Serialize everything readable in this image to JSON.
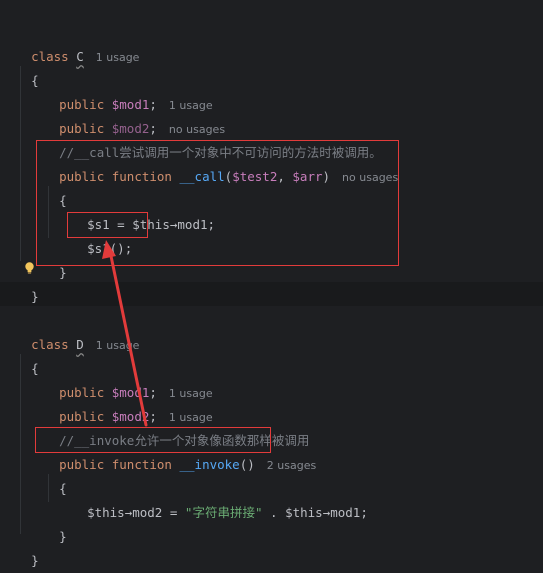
{
  "class_c": {
    "decl_kw": "class",
    "name": "C",
    "usage": "1 usage",
    "open": "{",
    "mod1": {
      "kw": "public",
      "var": "$mod1",
      "semi": ";",
      "usage": "1 usage"
    },
    "mod2": {
      "kw": "public",
      "var": "$mod2",
      "semi": ";",
      "usage": "no usages"
    },
    "comment_prefix": "//",
    "comment_code": "__call",
    "comment_text": "尝试调用一个对象中不可访问的方法时被调用。",
    "call_fn": {
      "kw1": "public",
      "kw2": "function",
      "name": "__call",
      "paren_open": "(",
      "arg1": "$test2",
      "comma": ", ",
      "arg2": "$arr",
      "paren_close": ")",
      "usage": "no usages"
    },
    "fn_open": "{",
    "line_assign": {
      "lhs": "$s1",
      "eq": " = ",
      "this": "$this",
      "arrow": "→",
      "prop": "mod1",
      "semi": ";"
    },
    "line_call": {
      "var": "$s1",
      "rest": "();"
    },
    "fn_close": "}",
    "close": "}"
  },
  "class_d": {
    "decl_kw": "class",
    "name": "D",
    "usage": "1 usage",
    "open": "{",
    "mod1": {
      "kw": "public",
      "var": "$mod1",
      "semi": ";",
      "usage": "1 usage"
    },
    "mod2": {
      "kw": "public",
      "var": "$mod2",
      "semi": ";",
      "usage": "1 usage"
    },
    "comment_prefix": "//",
    "comment_code": "__invoke",
    "comment_text": "允许一个对象像函数那样被调用",
    "invoke_fn": {
      "kw1": "public",
      "kw2": "function",
      "name": "__invoke",
      "parens": "()",
      "usage": "2 usages"
    },
    "fn_open": "{",
    "line_assign": {
      "this1": "$this",
      "arrow1": "→",
      "prop1": "mod2",
      "eq": " = ",
      "str": "\"字符串拼接\"",
      "dot": " . ",
      "this2": "$this",
      "arrow2": "→",
      "prop2": "mod1",
      "semi": ";"
    },
    "fn_close": "}",
    "close": "}"
  },
  "colors": {
    "background": "#1e1f22",
    "keyword": "#cf8e6d",
    "variable": "#c77dbb",
    "function": "#56a8f5",
    "string": "#6aab73",
    "comment": "#7a7e85",
    "highlight_box": "#e23b3b"
  },
  "icons": {
    "intention": "lightbulb-icon",
    "annotation": "red-arrow"
  }
}
